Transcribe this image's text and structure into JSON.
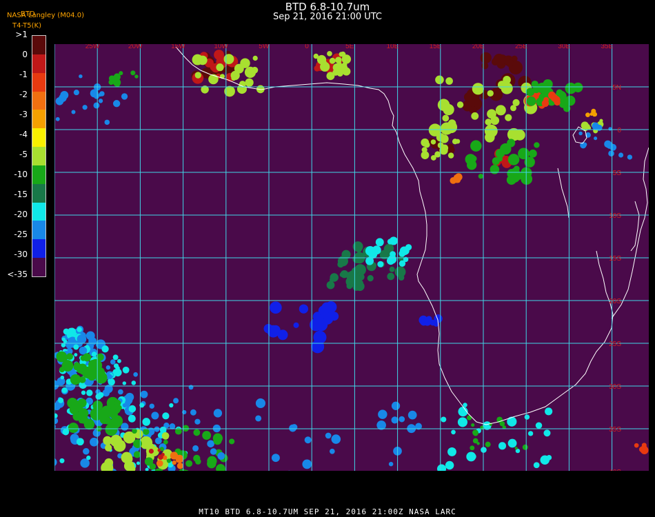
{
  "header": {
    "title": "BTD 6.8-10.7um",
    "subtitle": "Sep 21, 2016 21:00 UTC",
    "corner_line1": "NASA Langley (M04.0)",
    "corner_line1b": "BTD",
    "corner_line2": "T4-T5(K)"
  },
  "legend": {
    "labels": [
      ">1",
      "0",
      "-1",
      "-2",
      "-3",
      "-4",
      "-5",
      "-10",
      "-15",
      "-20",
      "-25",
      "-30",
      "<-35"
    ],
    "colors": [
      "#5a0a0a",
      "#c01818",
      "#e83a10",
      "#f07010",
      "#f4a000",
      "#f8f000",
      "#a8e030",
      "#18a818",
      "#187848",
      "#10e8e8",
      "#1888e8",
      "#1020e8",
      "#4a0a4a"
    ]
  },
  "map": {
    "background": "#4a0a4a",
    "grid_color": "#40d8e8",
    "coast_color": "#ffffff",
    "lon_labels": [
      "25W",
      "20W",
      "15W",
      "10W",
      "5W",
      "0",
      "5E",
      "10E",
      "15E",
      "20E",
      "25E",
      "30E",
      "35E"
    ],
    "lat_labels": [
      "5N",
      "0",
      "5S",
      "10S",
      "15S",
      "20S",
      "25S",
      "30S",
      "35S",
      "40S"
    ]
  },
  "footer": "MT10   BTD 6.8-10.7UM    SEP 21, 2016 21:00Z    NASA LARC"
}
